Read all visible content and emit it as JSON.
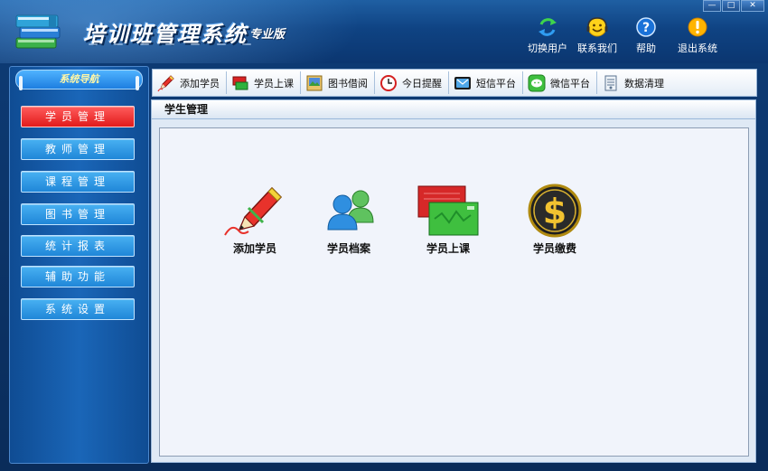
{
  "header": {
    "title": "培训班管理系统",
    "edition": "专业版",
    "actions": [
      {
        "label": "切换用户",
        "icon": "switch-user-icon"
      },
      {
        "label": "联系我们",
        "icon": "contact-smiley-icon"
      },
      {
        "label": "帮助",
        "icon": "help-icon"
      },
      {
        "label": "退出系统",
        "icon": "exit-alert-icon"
      }
    ],
    "window_controls": {
      "minimize": "—",
      "maximize": "□",
      "close": "✕"
    }
  },
  "sidebar": {
    "title": "系统导航",
    "items": [
      {
        "label": "学员管理",
        "active": true
      },
      {
        "label": "教师管理",
        "active": false
      },
      {
        "label": "课程管理",
        "active": false
      },
      {
        "label": "图书管理",
        "active": false
      },
      {
        "label": "统计报表",
        "active": false
      },
      {
        "label": "辅助功能",
        "active": false
      },
      {
        "label": "系统设置",
        "active": false
      }
    ]
  },
  "toolbar": {
    "items": [
      {
        "label": "添加学员",
        "icon": "pencil-icon"
      },
      {
        "label": "学员上课",
        "icon": "tickets-icon"
      },
      {
        "label": "图书借阅",
        "icon": "book-icon"
      },
      {
        "label": "今日提醒",
        "icon": "clock-icon"
      },
      {
        "label": "短信平台",
        "icon": "message-icon"
      },
      {
        "label": "微信平台",
        "icon": "wechat-icon"
      },
      {
        "label": "数据清理",
        "icon": "cleanup-icon"
      }
    ]
  },
  "panel": {
    "title": "学生管理",
    "shortcuts": [
      {
        "label": "添加学员",
        "icon": "pen-icon"
      },
      {
        "label": "学员档案",
        "icon": "people-icon"
      },
      {
        "label": "学员上课",
        "icon": "ticket-icon"
      },
      {
        "label": "学员缴费",
        "icon": "dollar-coin-icon"
      }
    ]
  },
  "colors": {
    "accent_active": "#e21b1b",
    "sidebar_button": "#2a8fe0",
    "header_bg": "#0f4383"
  }
}
